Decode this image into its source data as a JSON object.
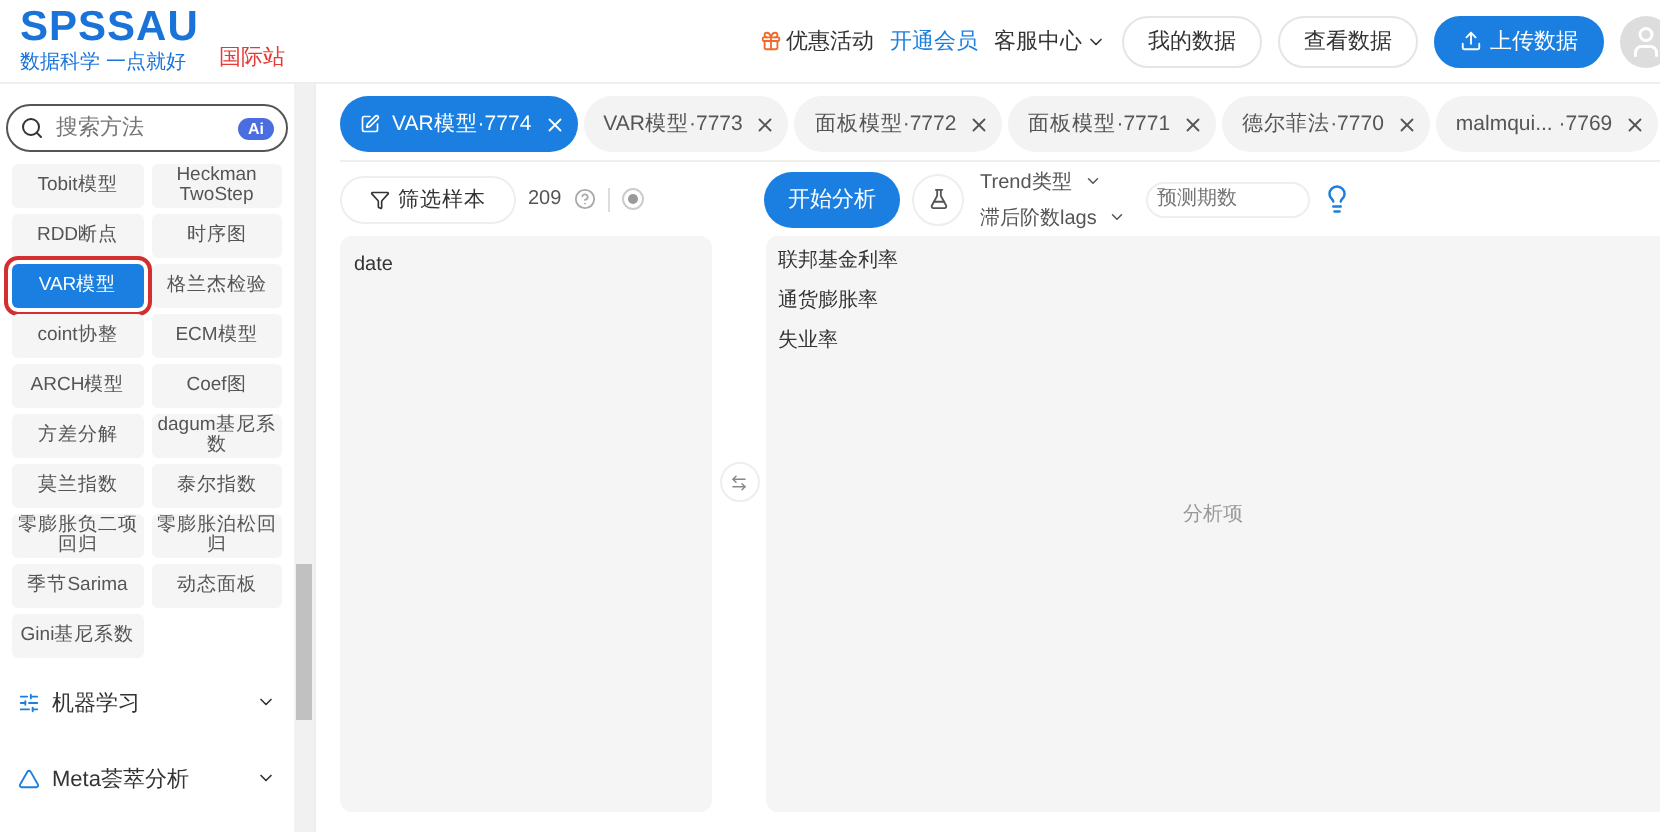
{
  "header": {
    "logo": "SPSSAU",
    "tagline": "数据科学 一点就好",
    "site_link": "国际站",
    "nav": [
      {
        "label": "优惠活动",
        "kind": "promo"
      },
      {
        "label": "开通会员",
        "kind": "member"
      },
      {
        "label": "客服中心",
        "kind": "menu"
      }
    ],
    "buttons": [
      {
        "label": "我的数据",
        "kind": "outline"
      },
      {
        "label": "查看数据",
        "kind": "outline"
      },
      {
        "label": "上传数据",
        "kind": "primary"
      }
    ]
  },
  "sidebar": {
    "search": {
      "placeholder": "搜索方法"
    },
    "ai_badge": "Ai",
    "methods": [
      {
        "label": "Tobit模型",
        "selected": false
      },
      {
        "label": "Heckman TwoStep",
        "selected": false
      },
      {
        "label": "RDD断点",
        "selected": false
      },
      {
        "label": "时序图",
        "selected": false
      },
      {
        "label": "VAR模型",
        "selected": true
      },
      {
        "label": "格兰杰检验",
        "selected": false
      },
      {
        "label": "coint协整",
        "selected": false
      },
      {
        "label": "ECM模型",
        "selected": false
      },
      {
        "label": "ARCH模型",
        "selected": false
      },
      {
        "label": "Coef图",
        "selected": false
      },
      {
        "label": "方差分解",
        "selected": false
      },
      {
        "label": "dagum基尼系数",
        "selected": false
      },
      {
        "label": "莫兰指数",
        "selected": false
      },
      {
        "label": "泰尔指数",
        "selected": false
      },
      {
        "label": "零膨胀负二项回归",
        "selected": false
      },
      {
        "label": "零膨胀泊松回归",
        "selected": false
      },
      {
        "label": "季节Sarima",
        "selected": false
      },
      {
        "label": "动态面板",
        "selected": false
      },
      {
        "label": "Gini基尼系数",
        "selected": false
      }
    ],
    "categories": [
      {
        "label": "机器学习",
        "kind": "ml",
        "expanded": false
      },
      {
        "label": "Meta荟萃分析",
        "kind": "meta",
        "expanded": false
      }
    ]
  },
  "tabs": [
    {
      "label": "VAR模型·7774",
      "selected": true
    },
    {
      "label": "VAR模型·7773",
      "selected": false
    },
    {
      "label": "面板模型·7772",
      "selected": false
    },
    {
      "label": "面板模型·7771",
      "selected": false
    },
    {
      "label": "德尔菲法·7770",
      "selected": false
    },
    {
      "label": "malmqui... ·7769",
      "selected": false
    }
  ],
  "toolbar": {
    "filter_button": "筛选样本",
    "sample_count": "209",
    "run_button": "开始分析",
    "dropdowns": [
      "Trend类型",
      "滞后阶数lags"
    ],
    "forecast_field": {
      "placeholder": "预测期数"
    }
  },
  "variables": [
    "date"
  ],
  "analysis_items": [
    "联邦基金利率",
    "通货膨胀率",
    "失业率"
  ],
  "analysis_placeholder": "分析项"
}
